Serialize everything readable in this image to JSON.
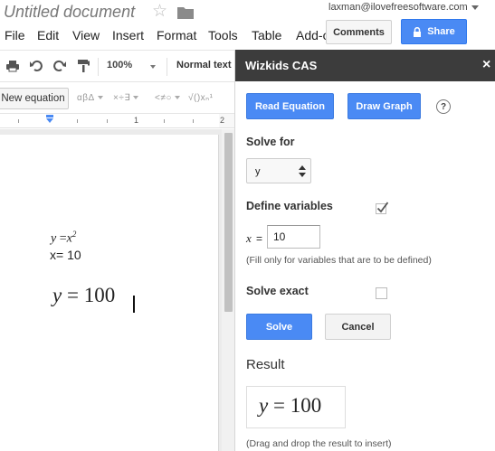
{
  "doc": {
    "title": "Untitled document",
    "user_email": "laxman@ilovefreesoftware.com"
  },
  "menu": [
    "File",
    "Edit",
    "View",
    "Insert",
    "Format",
    "Tools",
    "Table",
    "Add-o"
  ],
  "header_buttons": {
    "comments": "Comments",
    "share": "Share"
  },
  "toolbar": {
    "zoom": "100%",
    "style": "Normal text"
  },
  "equation_bar": {
    "new_equation": "New equation",
    "groups": [
      "αβΔ",
      "×÷∃",
      "<≠○",
      "√()xₙ¹"
    ]
  },
  "ruler": {
    "numbers": [
      "1",
      "2"
    ]
  },
  "document_content": {
    "line1_lhs": "y",
    "line1_op": "=",
    "line1_base": "x",
    "line1_exp": "2",
    "line2": "x= 10",
    "result_line": "y = 100"
  },
  "panel": {
    "title": "Wizkids CAS",
    "close": "×",
    "read_equation": "Read Equation",
    "draw_graph": "Draw Graph",
    "help": "?",
    "solve_for_label": "Solve for",
    "solve_for_value": "y",
    "define_vars_label": "Define variables",
    "define_vars_checked": true,
    "var_name": "x",
    "var_eq": "=",
    "var_value": "10",
    "var_hint": "(Fill only for variables that are to be defined)",
    "solve_exact_label": "Solve exact",
    "solve_exact_checked": false,
    "solve": "Solve",
    "cancel": "Cancel",
    "result_label": "Result",
    "result_value": "y = 100",
    "result_hint": "(Drag and drop the result to insert)"
  },
  "colors": {
    "accent_blue": "#4a8af4",
    "panel_header": "#3c3c3c"
  },
  "icons": [
    "star-icon",
    "folder-icon",
    "lock-icon",
    "print-icon",
    "undo-icon",
    "redo-icon",
    "paint-format-icon",
    "help-icon",
    "close-icon",
    "checkmark-icon",
    "select-arrows-icon"
  ]
}
